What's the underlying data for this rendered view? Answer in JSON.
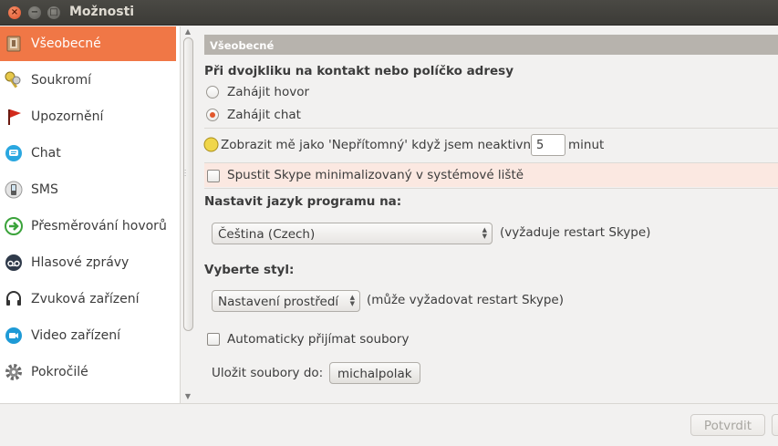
{
  "window": {
    "title": "Možnosti"
  },
  "sidebar": {
    "items": [
      {
        "label": "Všeobecné",
        "icon": "general-icon"
      },
      {
        "label": "Soukromí",
        "icon": "privacy-icon"
      },
      {
        "label": "Upozornění",
        "icon": "notifications-flag-icon"
      },
      {
        "label": "Chat",
        "icon": "chat-icon"
      },
      {
        "label": "SMS",
        "icon": "sms-phone-icon"
      },
      {
        "label": "Přesměrování hovorů",
        "icon": "call-forwarding-icon"
      },
      {
        "label": "Hlasové zprávy",
        "icon": "voicemail-icon"
      },
      {
        "label": "Zvuková zařízení",
        "icon": "headset-icon"
      },
      {
        "label": "Video zařízení",
        "icon": "video-camera-icon"
      },
      {
        "label": "Pokročilé",
        "icon": "gear-icon"
      }
    ],
    "selected_index": 0
  },
  "main": {
    "section_title": "Všeobecné",
    "double_click_heading": "Při dvojkliku na kontakt nebo políčko adresy",
    "radio_call": "Zahájit hovor",
    "radio_chat": "Zahájit chat",
    "away_label": "Zobrazit mě jako 'Nepřítomný' když jsem neaktivní",
    "away_value": "5",
    "away_unit": "minut",
    "start_minimized": "Spustit Skype minimalizovaný v systémové liště",
    "language_heading": "Nastavit jazyk programu na:",
    "language_value": "Čeština (Czech)",
    "language_note": "(vyžaduje restart Skype)",
    "style_heading": "Vyberte styl:",
    "style_value": "Nastavení prostředí",
    "style_note": "(může vyžadovat restart Skype)",
    "auto_accept": "Automaticky přijímat soubory",
    "save_label": "Uložit soubory do:",
    "save_folder": "michalpolak"
  },
  "footer": {
    "confirm": "Potvrdit"
  },
  "colors": {
    "accent": "#f07746",
    "header": "#b7b3ad",
    "highlight": "#fbe8e1"
  }
}
